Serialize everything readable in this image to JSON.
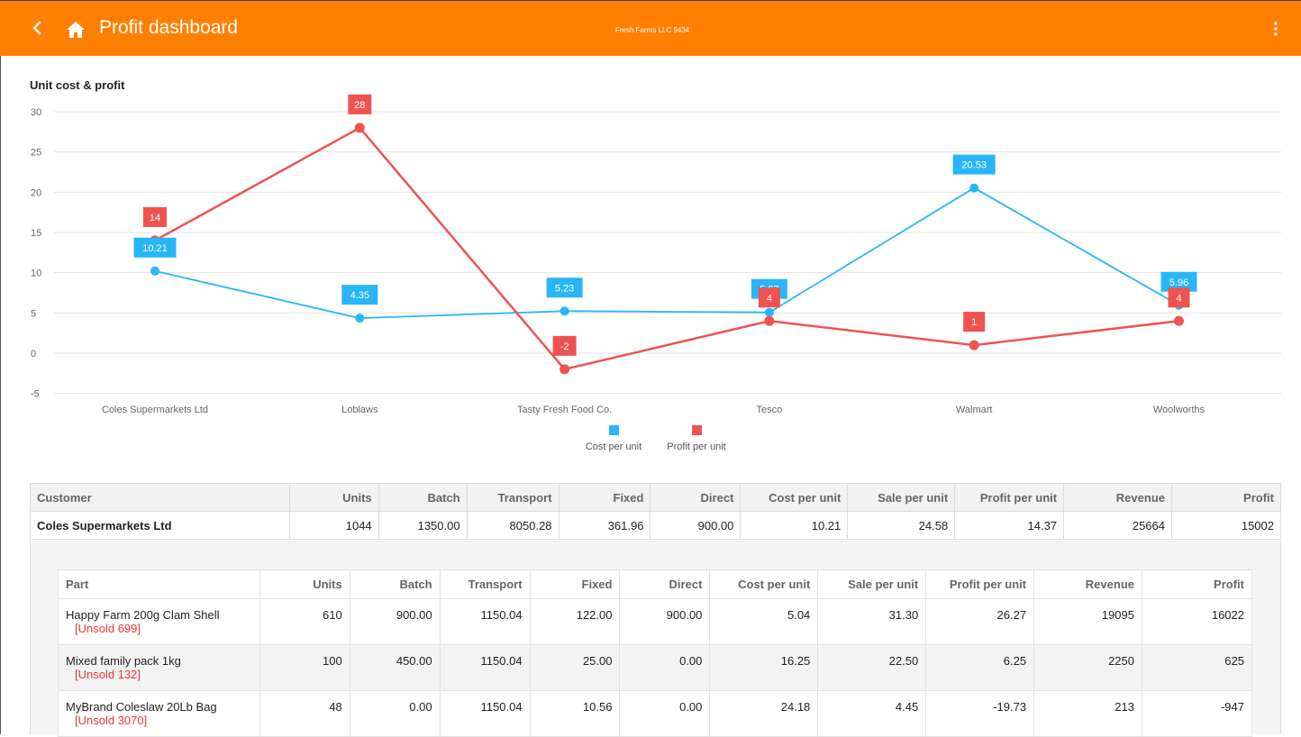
{
  "appbar": {
    "title": "Profit dashboard",
    "company": "Fresh Farms LLC 9434",
    "icons": [
      "chevron-left-icon",
      "home-icon",
      "more-vert-icon"
    ],
    "color": "#ff8000"
  },
  "chart_data": {
    "type": "line",
    "title": "Unit cost & profit",
    "categories": [
      "Coles Supermarkets Ltd",
      "Loblaws",
      "Tasty Fresh Food Co.",
      "Tesco",
      "Walmart",
      "Woolworths"
    ],
    "series": [
      {
        "name": "Cost per unit",
        "color": "#29b6f6",
        "values": [
          10.21,
          4.35,
          5.23,
          5.07,
          20.53,
          5.96
        ],
        "labels": [
          "10.21",
          "4.35",
          "5.23",
          "5.07",
          "20.53",
          "5.96"
        ]
      },
      {
        "name": "Profit per unit",
        "color": "#ef5350",
        "values": [
          14,
          28,
          -2,
          4,
          1,
          4
        ],
        "labels": [
          "14",
          "28",
          "-2",
          "4",
          "1",
          "4"
        ]
      }
    ],
    "ylim": [
      -5,
      30
    ],
    "yticks": [
      30,
      25,
      20,
      15,
      10,
      5,
      0,
      -5
    ],
    "grid": true,
    "legend": "bottom"
  },
  "summary_table": {
    "headers": [
      "Customer",
      "Units",
      "Batch",
      "Transport",
      "Fixed",
      "Direct",
      "Cost per unit",
      "Sale per unit",
      "Profit per unit",
      "Revenue",
      "Profit"
    ],
    "rows": [
      [
        "Coles Supermarkets Ltd",
        "1044",
        "1350.00",
        "8050.28",
        "361.96",
        "900.00",
        "10.21",
        "24.58",
        "14.37",
        "25664",
        "15002"
      ]
    ]
  },
  "parts_table": {
    "headers": [
      "Part",
      "Units",
      "Batch",
      "Transport",
      "Fixed",
      "Direct",
      "Cost per unit",
      "Sale per unit",
      "Profit per unit",
      "Revenue",
      "Profit"
    ],
    "rows": [
      {
        "part": "Happy Farm 200g Clam Shell",
        "unsold": "[Unsold 699]",
        "cells": [
          "610",
          "900.00",
          "1150.04",
          "122.00",
          "900.00",
          "5.04",
          "31.30",
          "26.27",
          "19095",
          "16022"
        ]
      },
      {
        "part": "Mixed family pack 1kg",
        "unsold": "[Unsold 132]",
        "cells": [
          "100",
          "450.00",
          "1150.04",
          "25.00",
          "0.00",
          "16.25",
          "22.50",
          "6.25",
          "2250",
          "625"
        ]
      },
      {
        "part": "MyBrand Coleslaw 20Lb Bag",
        "unsold": "[Unsold 3070]",
        "cells": [
          "48",
          "0.00",
          "1150.04",
          "10.56",
          "0.00",
          "24.18",
          "4.45",
          "-19.73",
          "213",
          "-947"
        ]
      }
    ]
  }
}
